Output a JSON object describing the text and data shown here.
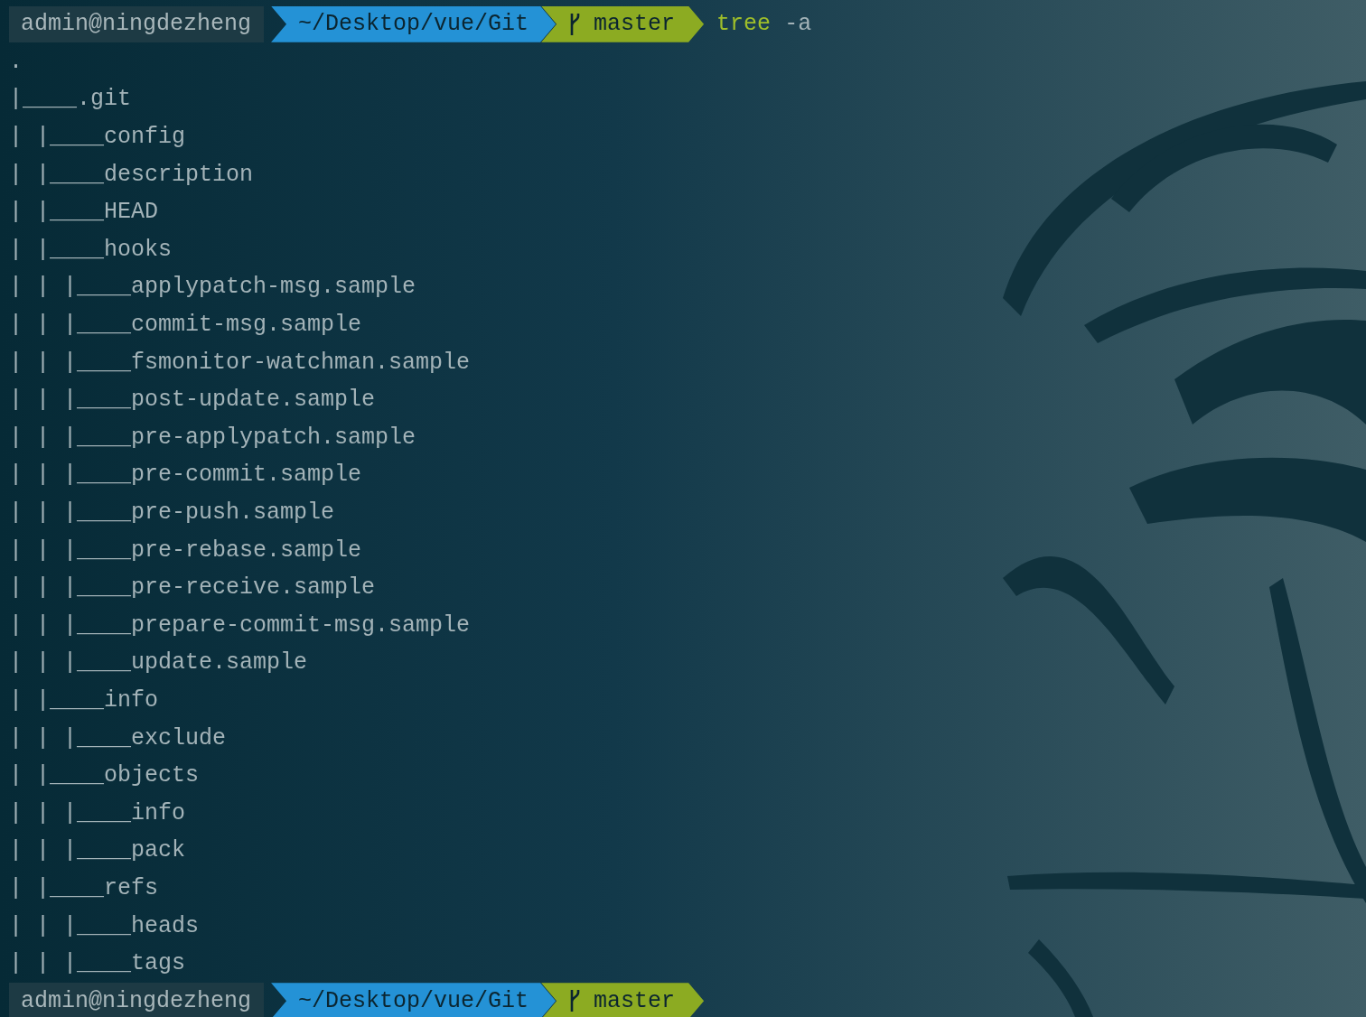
{
  "prompts": [
    {
      "user": "admin@ningdezheng",
      "path": "~/Desktop/vue/Git",
      "branch": "master",
      "command": "tree",
      "args": "-a"
    },
    {
      "user": "admin@ningdezheng",
      "path": "~/Desktop/vue/Git",
      "branch": "master"
    }
  ],
  "output": {
    "root": ".",
    "tree": [
      {
        "text": "|____.git",
        "children": [
          {
            "text": "| |____config"
          },
          {
            "text": "| |____description"
          },
          {
            "text": "| |____HEAD"
          },
          {
            "text": "| |____hooks",
            "children": [
              {
                "text": "| | |____applypatch-msg.sample"
              },
              {
                "text": "| | |____commit-msg.sample"
              },
              {
                "text": "| | |____fsmonitor-watchman.sample"
              },
              {
                "text": "| | |____post-update.sample"
              },
              {
                "text": "| | |____pre-applypatch.sample"
              },
              {
                "text": "| | |____pre-commit.sample"
              },
              {
                "text": "| | |____pre-push.sample"
              },
              {
                "text": "| | |____pre-rebase.sample"
              },
              {
                "text": "| | |____pre-receive.sample"
              },
              {
                "text": "| | |____prepare-commit-msg.sample"
              },
              {
                "text": "| | |____update.sample"
              }
            ]
          },
          {
            "text": "| |____info",
            "children": [
              {
                "text": "| | |____exclude"
              }
            ]
          },
          {
            "text": "| |____objects",
            "children": [
              {
                "text": "| | |____info"
              },
              {
                "text": "| | |____pack"
              }
            ]
          },
          {
            "text": "| |____refs",
            "children": [
              {
                "text": "| | |____heads"
              },
              {
                "text": "| | |____tags"
              }
            ]
          }
        ]
      }
    ]
  }
}
